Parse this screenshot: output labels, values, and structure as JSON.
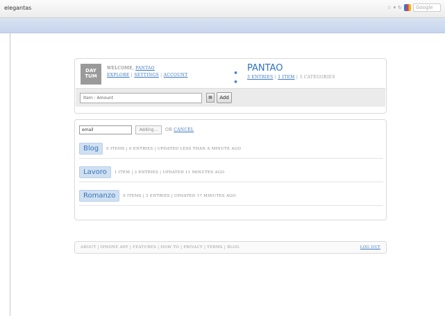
{
  "browser": {
    "address": "elegantas",
    "search_label": "Google"
  },
  "header": {
    "logo_line1": "DAY",
    "logo_line2": "TUM",
    "welcome_prefix": "WELCOME,",
    "welcome_user": "PANTAO",
    "links": [
      "EXPLORE",
      "SETTINGS",
      "ACCOUNT"
    ],
    "user_name": "PANTAO",
    "user_dots": "• •",
    "user_stats_entries": "3 ENTRIES",
    "user_stats_item": "1 ITEM",
    "user_stats_categories": "3 CATEGORIES",
    "entry_placeholder": "Item : Amount",
    "add_label": "Add"
  },
  "new_category": {
    "value": "email",
    "adding_label": "Adding...",
    "or_text": "OR",
    "cancel_label": "CANCEL"
  },
  "categories": [
    {
      "name": "Blog",
      "meta": "0 ITEMS | 0 ENTRIES | UPDATED LESS THAN A MINUTE AGO"
    },
    {
      "name": "Lavoro",
      "meta": "1 ITEM | 3 ENTRIES | UPDATED 11 MINUTES AGO"
    },
    {
      "name": "Romanzo",
      "meta": "0 ITEMS | 3 ENTRIES | UPDATED 17 MINUTES AGO"
    }
  ],
  "footer": {
    "links": "ABOUT | IPHONE APP | FEATURES | HOW TO | PRIVACY | TERMS | BLOG",
    "logout": "LOG OUT"
  }
}
